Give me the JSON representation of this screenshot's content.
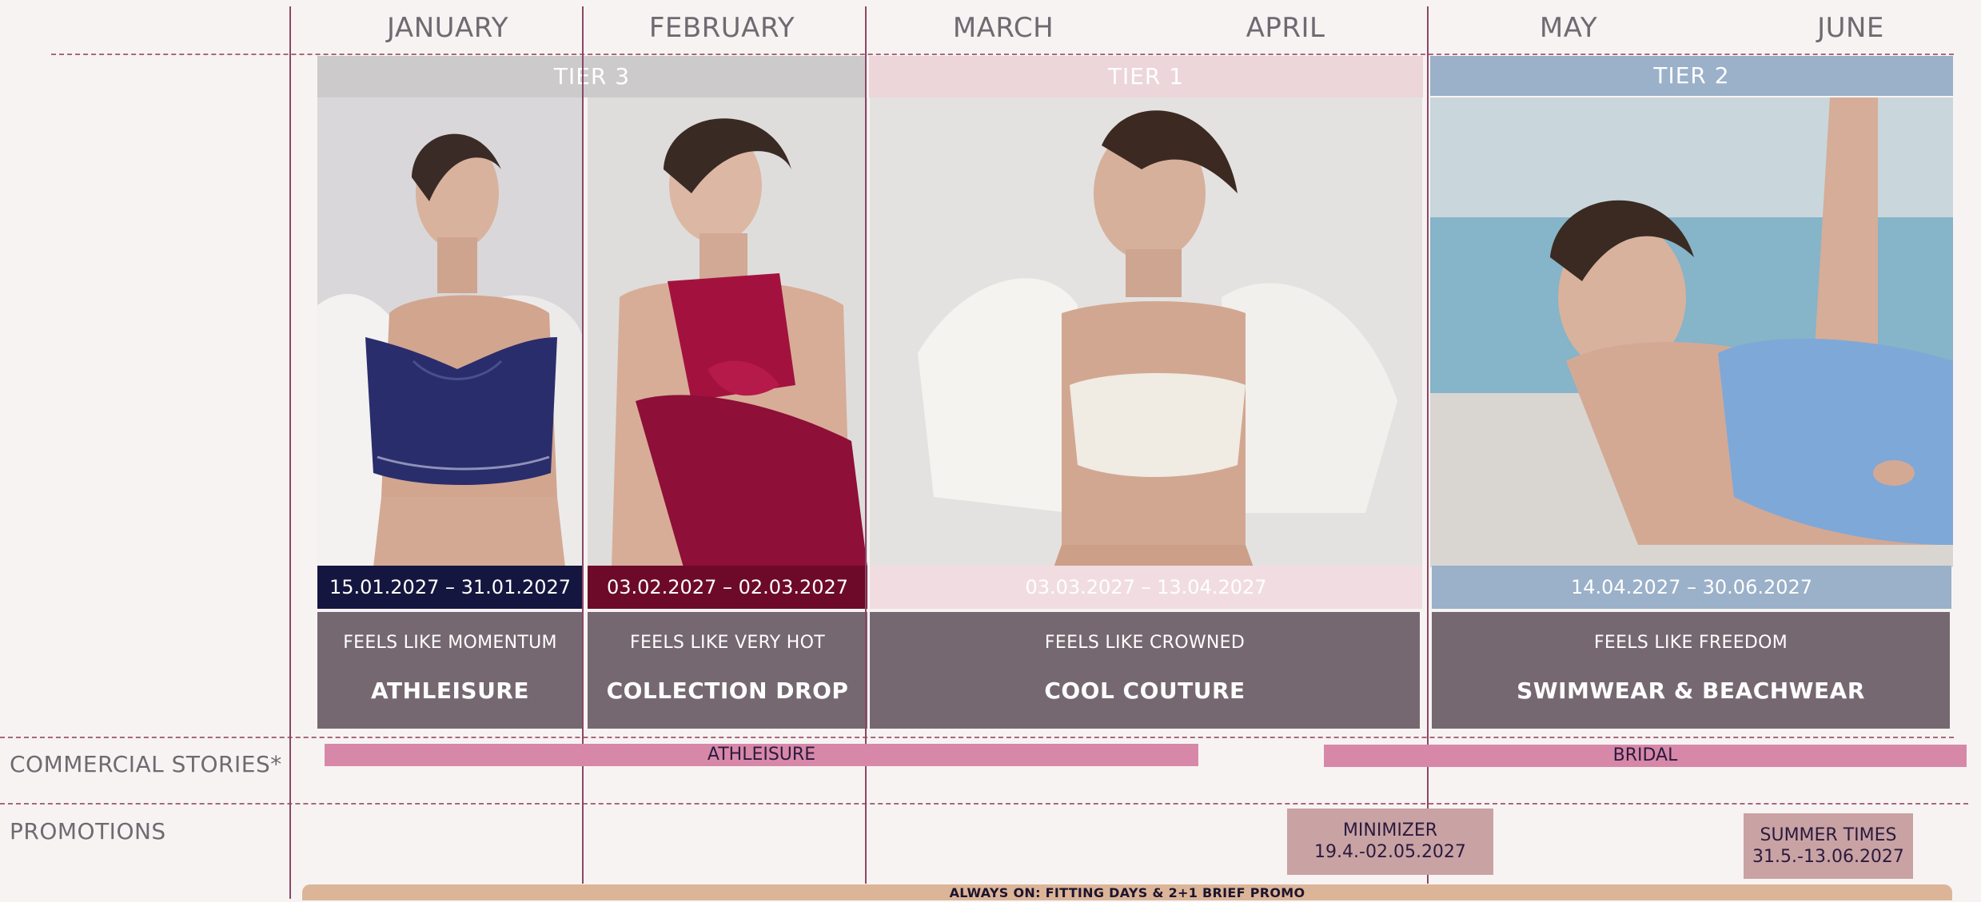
{
  "months": [
    "JANUARY",
    "FEBRUARY",
    "MARCH",
    "APRIL",
    "MAY",
    "JUNE"
  ],
  "tiers": [
    {
      "label": "TIER 3",
      "color": "#cdcacc"
    },
    {
      "label": "TIER 1",
      "color": "#ecd6da"
    },
    {
      "label": "TIER 2",
      "color": "#9bb0c9"
    }
  ],
  "campaigns": [
    {
      "date_range": "15.01.2027 – 31.01.2027",
      "tagline": "FEELS LIKE MOMENTUM",
      "title": "ATHLEISURE",
      "date_color": "#15163f",
      "image": "model-navy-sports-bra"
    },
    {
      "date_range": "03.02.2027 – 02.03.2027",
      "tagline": "FEELS LIKE VERY HOT",
      "title": "COLLECTION DROP",
      "date_color": "#6d0a2a",
      "image": "model-burgundy-lingerie"
    },
    {
      "date_range": "03.03.2027 – 13.04.2027",
      "tagline": "FEELS LIKE CROWNED",
      "title": "COOL COUTURE",
      "date_color": "#f1dde1",
      "image": "model-white-bra-jacket"
    },
    {
      "date_range": "14.04.2027 – 30.06.2027",
      "tagline": "FEELS LIKE FREEDOM",
      "title": "SWIMWEAR & BEACHWEAR",
      "date_color": "#9bb0c9",
      "image": "model-blue-swimsuit"
    }
  ],
  "rows": {
    "commercial_stories": "COMMERCIAL STORIES*",
    "promotions": "PROMOTIONS"
  },
  "commercial": [
    {
      "label": "ATHLEISURE"
    },
    {
      "label": "BRIDAL"
    }
  ],
  "promotions": [
    {
      "name": "MINIMIZER",
      "dates": "19.4.-02.05.2027"
    },
    {
      "name": "SUMMER TIMES",
      "dates": "31.5.-13.06.2027"
    }
  ],
  "always_on": "ALWAYS ON: FITTING DAYS & 2+1 BRIEF PROMO",
  "colors": {
    "background": "#f7f3f2",
    "grid_line": "#8a4766",
    "story_box": "#766870",
    "commercial_bar": "#d788a8",
    "promo_box": "#c9a2a4",
    "always_on_bar": "#dcb598",
    "month_text": "#6f6a71"
  }
}
